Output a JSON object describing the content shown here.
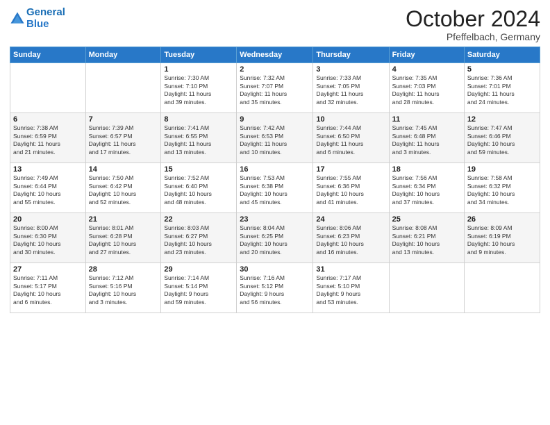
{
  "header": {
    "logo_line1": "General",
    "logo_line2": "Blue",
    "title": "October 2024",
    "subtitle": "Pfeffelbach, Germany"
  },
  "weekdays": [
    "Sunday",
    "Monday",
    "Tuesday",
    "Wednesday",
    "Thursday",
    "Friday",
    "Saturday"
  ],
  "weeks": [
    [
      {
        "day": "",
        "info": ""
      },
      {
        "day": "",
        "info": ""
      },
      {
        "day": "1",
        "info": "Sunrise: 7:30 AM\nSunset: 7:10 PM\nDaylight: 11 hours\nand 39 minutes."
      },
      {
        "day": "2",
        "info": "Sunrise: 7:32 AM\nSunset: 7:07 PM\nDaylight: 11 hours\nand 35 minutes."
      },
      {
        "day": "3",
        "info": "Sunrise: 7:33 AM\nSunset: 7:05 PM\nDaylight: 11 hours\nand 32 minutes."
      },
      {
        "day": "4",
        "info": "Sunrise: 7:35 AM\nSunset: 7:03 PM\nDaylight: 11 hours\nand 28 minutes."
      },
      {
        "day": "5",
        "info": "Sunrise: 7:36 AM\nSunset: 7:01 PM\nDaylight: 11 hours\nand 24 minutes."
      }
    ],
    [
      {
        "day": "6",
        "info": "Sunrise: 7:38 AM\nSunset: 6:59 PM\nDaylight: 11 hours\nand 21 minutes."
      },
      {
        "day": "7",
        "info": "Sunrise: 7:39 AM\nSunset: 6:57 PM\nDaylight: 11 hours\nand 17 minutes."
      },
      {
        "day": "8",
        "info": "Sunrise: 7:41 AM\nSunset: 6:55 PM\nDaylight: 11 hours\nand 13 minutes."
      },
      {
        "day": "9",
        "info": "Sunrise: 7:42 AM\nSunset: 6:53 PM\nDaylight: 11 hours\nand 10 minutes."
      },
      {
        "day": "10",
        "info": "Sunrise: 7:44 AM\nSunset: 6:50 PM\nDaylight: 11 hours\nand 6 minutes."
      },
      {
        "day": "11",
        "info": "Sunrise: 7:45 AM\nSunset: 6:48 PM\nDaylight: 11 hours\nand 3 minutes."
      },
      {
        "day": "12",
        "info": "Sunrise: 7:47 AM\nSunset: 6:46 PM\nDaylight: 10 hours\nand 59 minutes."
      }
    ],
    [
      {
        "day": "13",
        "info": "Sunrise: 7:49 AM\nSunset: 6:44 PM\nDaylight: 10 hours\nand 55 minutes."
      },
      {
        "day": "14",
        "info": "Sunrise: 7:50 AM\nSunset: 6:42 PM\nDaylight: 10 hours\nand 52 minutes."
      },
      {
        "day": "15",
        "info": "Sunrise: 7:52 AM\nSunset: 6:40 PM\nDaylight: 10 hours\nand 48 minutes."
      },
      {
        "day": "16",
        "info": "Sunrise: 7:53 AM\nSunset: 6:38 PM\nDaylight: 10 hours\nand 45 minutes."
      },
      {
        "day": "17",
        "info": "Sunrise: 7:55 AM\nSunset: 6:36 PM\nDaylight: 10 hours\nand 41 minutes."
      },
      {
        "day": "18",
        "info": "Sunrise: 7:56 AM\nSunset: 6:34 PM\nDaylight: 10 hours\nand 37 minutes."
      },
      {
        "day": "19",
        "info": "Sunrise: 7:58 AM\nSunset: 6:32 PM\nDaylight: 10 hours\nand 34 minutes."
      }
    ],
    [
      {
        "day": "20",
        "info": "Sunrise: 8:00 AM\nSunset: 6:30 PM\nDaylight: 10 hours\nand 30 minutes."
      },
      {
        "day": "21",
        "info": "Sunrise: 8:01 AM\nSunset: 6:28 PM\nDaylight: 10 hours\nand 27 minutes."
      },
      {
        "day": "22",
        "info": "Sunrise: 8:03 AM\nSunset: 6:27 PM\nDaylight: 10 hours\nand 23 minutes."
      },
      {
        "day": "23",
        "info": "Sunrise: 8:04 AM\nSunset: 6:25 PM\nDaylight: 10 hours\nand 20 minutes."
      },
      {
        "day": "24",
        "info": "Sunrise: 8:06 AM\nSunset: 6:23 PM\nDaylight: 10 hours\nand 16 minutes."
      },
      {
        "day": "25",
        "info": "Sunrise: 8:08 AM\nSunset: 6:21 PM\nDaylight: 10 hours\nand 13 minutes."
      },
      {
        "day": "26",
        "info": "Sunrise: 8:09 AM\nSunset: 6:19 PM\nDaylight: 10 hours\nand 9 minutes."
      }
    ],
    [
      {
        "day": "27",
        "info": "Sunrise: 7:11 AM\nSunset: 5:17 PM\nDaylight: 10 hours\nand 6 minutes."
      },
      {
        "day": "28",
        "info": "Sunrise: 7:12 AM\nSunset: 5:16 PM\nDaylight: 10 hours\nand 3 minutes."
      },
      {
        "day": "29",
        "info": "Sunrise: 7:14 AM\nSunset: 5:14 PM\nDaylight: 9 hours\nand 59 minutes."
      },
      {
        "day": "30",
        "info": "Sunrise: 7:16 AM\nSunset: 5:12 PM\nDaylight: 9 hours\nand 56 minutes."
      },
      {
        "day": "31",
        "info": "Sunrise: 7:17 AM\nSunset: 5:10 PM\nDaylight: 9 hours\nand 53 minutes."
      },
      {
        "day": "",
        "info": ""
      },
      {
        "day": "",
        "info": ""
      }
    ]
  ]
}
